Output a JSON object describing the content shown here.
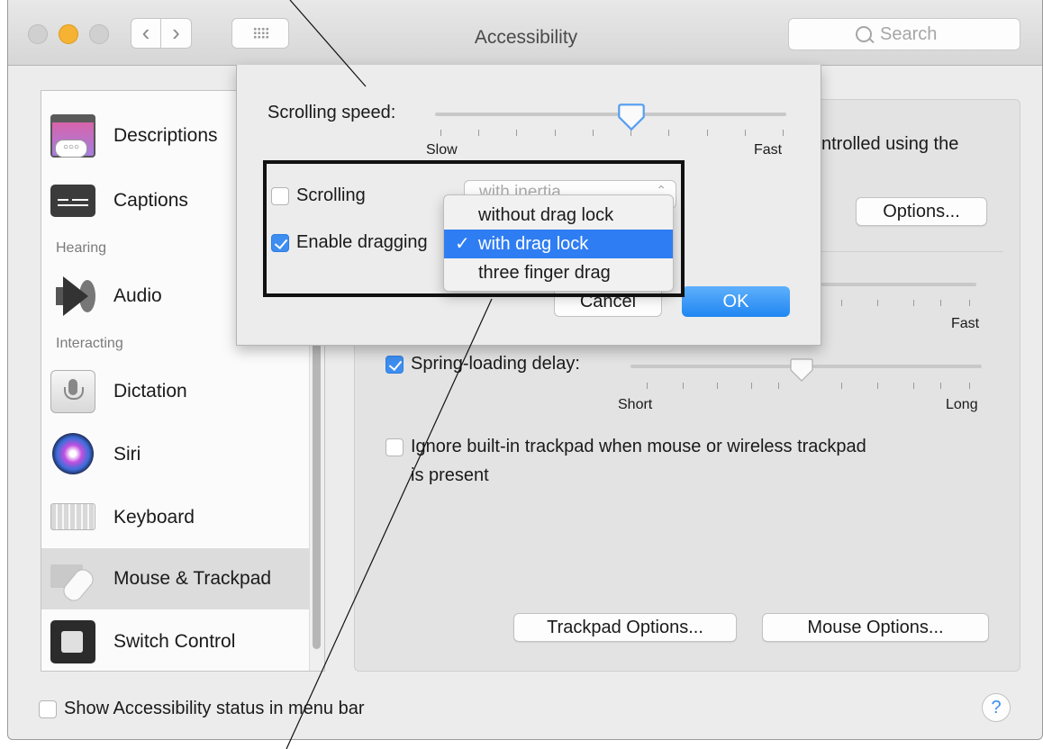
{
  "window": {
    "title": "Accessibility",
    "search_placeholder": "Search"
  },
  "sidebar": {
    "items": [
      {
        "label": "Descriptions"
      },
      {
        "label": "Captions"
      },
      {
        "label": "Audio"
      },
      {
        "label": "Dictation"
      },
      {
        "label": "Siri"
      },
      {
        "label": "Keyboard"
      },
      {
        "label": "Mouse & Trackpad"
      },
      {
        "label": "Switch Control"
      }
    ],
    "groups": {
      "hearing": "Hearing",
      "interacting": "Interacting"
    },
    "selected": "Mouse & Trackpad"
  },
  "panel": {
    "partial_text": "ntrolled using the",
    "options_button": "Options...",
    "fast_label": "Fast",
    "spring_loading_label": "Spring-loading delay:",
    "spring_loading_checked": true,
    "spring_short": "Short",
    "spring_long": "Long",
    "ignore_trackpad_line1": "Ignore built-in trackpad when mouse or wireless trackpad",
    "ignore_trackpad_line2": "is present",
    "ignore_trackpad_checked": false,
    "trackpad_options_button": "Trackpad Options...",
    "mouse_options_button": "Mouse Options..."
  },
  "footer": {
    "status_label": "Show Accessibility status in menu bar",
    "status_checked": false,
    "help_label": "?"
  },
  "sheet": {
    "scrolling_speed_label": "Scrolling speed:",
    "scroll_slow": "Slow",
    "scroll_fast": "Fast",
    "scroll_speed_value": 0.56,
    "scrolling_label": "Scrolling",
    "scrolling_checked": false,
    "scrolling_popup_value": "with inertia",
    "enable_dragging_label": "Enable dragging",
    "enable_dragging_checked": true,
    "cancel_button": "Cancel",
    "ok_button": "OK"
  },
  "drag_menu": {
    "items": [
      {
        "label": "without drag lock",
        "selected": false
      },
      {
        "label": "with drag lock",
        "selected": true
      },
      {
        "label": "three finger drag",
        "selected": false
      }
    ]
  },
  "colors": {
    "accent": "#2f7df2",
    "highlight_box": "#111111",
    "minimize": "#f5b233"
  },
  "icons": [
    "descriptions-icon",
    "captions-icon",
    "audio-icon",
    "dictation-icon",
    "siri-icon",
    "keyboard-icon",
    "mouse-trackpad-icon",
    "switch-control-icon",
    "search-icon",
    "back-icon",
    "forward-icon",
    "grid-icon"
  ]
}
